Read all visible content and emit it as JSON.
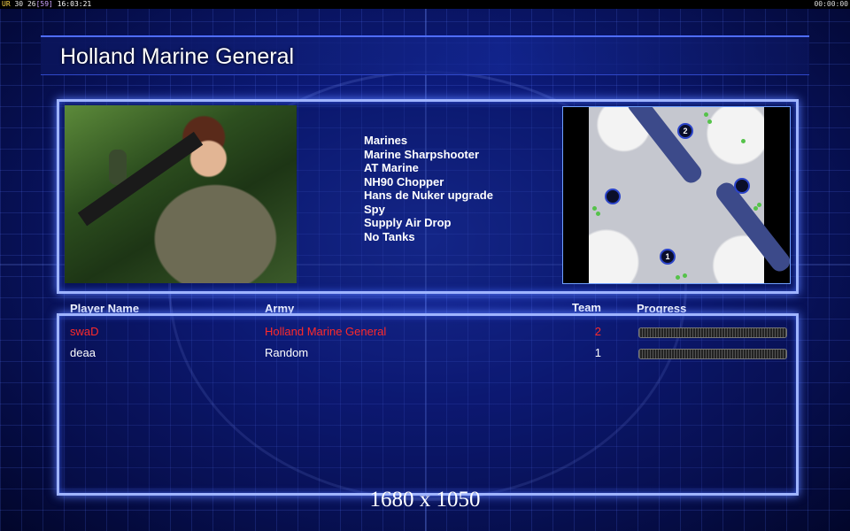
{
  "status_bar": {
    "ur": "UR",
    "n1": "30",
    "n2": "26",
    "n3": "[59]",
    "clock": "16:03:21",
    "timer": "00:00:00"
  },
  "header": {
    "title": "Holland Marine General"
  },
  "army_info": {
    "units": [
      "Marines",
      "Marine Sharpshooter",
      "AT Marine",
      "NH90 Chopper",
      "Hans de Nuker upgrade",
      "Spy",
      "Supply Air Drop",
      "No Tanks"
    ]
  },
  "minimap": {
    "bases": [
      "2",
      "",
      "",
      "1"
    ]
  },
  "players": {
    "columns": {
      "name": "Player Name",
      "army": "Army",
      "team": "Team",
      "progress": "Progress"
    },
    "rows": [
      {
        "name": "swaD",
        "army": "Holland Marine General",
        "team": "2",
        "color": "#ff2a2a"
      },
      {
        "name": "deaa",
        "army": "Random",
        "team": "1",
        "color": "#ffffff"
      }
    ]
  },
  "footer": {
    "resolution": "1680 x 1050"
  }
}
